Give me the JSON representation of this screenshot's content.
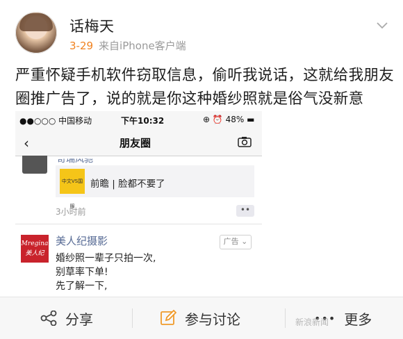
{
  "post": {
    "author": "话梅天",
    "date": "3-29",
    "source": "来自iPhone客户端",
    "text": "严重怀疑手机软件窃取信息，偷听我说话，这就给我朋友圈推广告了，说的就是你这种婚纱照就是俗气没新意"
  },
  "screenshot": {
    "status_bar": {
      "carrier": "●●○○○ 中国移动",
      "time": "下午10:32",
      "battery": "48%"
    },
    "nav_title": "朋友圈",
    "prev_post": {
      "author_partial": "奇瑞风驰",
      "link_thumb_text": "中文VS国服",
      "link_title": "前瞻 | 脸都不要了",
      "time_ago": "3小时前",
      "more_label": "••"
    },
    "ad": {
      "logo_text": "Mregina 美人纪",
      "name": "美人纪摄影",
      "badge": "广告",
      "lines": [
        "婚纱照一辈子只拍一次,",
        "别草率下单!",
        "先了解一下,"
      ]
    }
  },
  "actions": {
    "share": "分享",
    "comment": "参与讨论",
    "more": "更多"
  },
  "watermark": "新浪新闻"
}
